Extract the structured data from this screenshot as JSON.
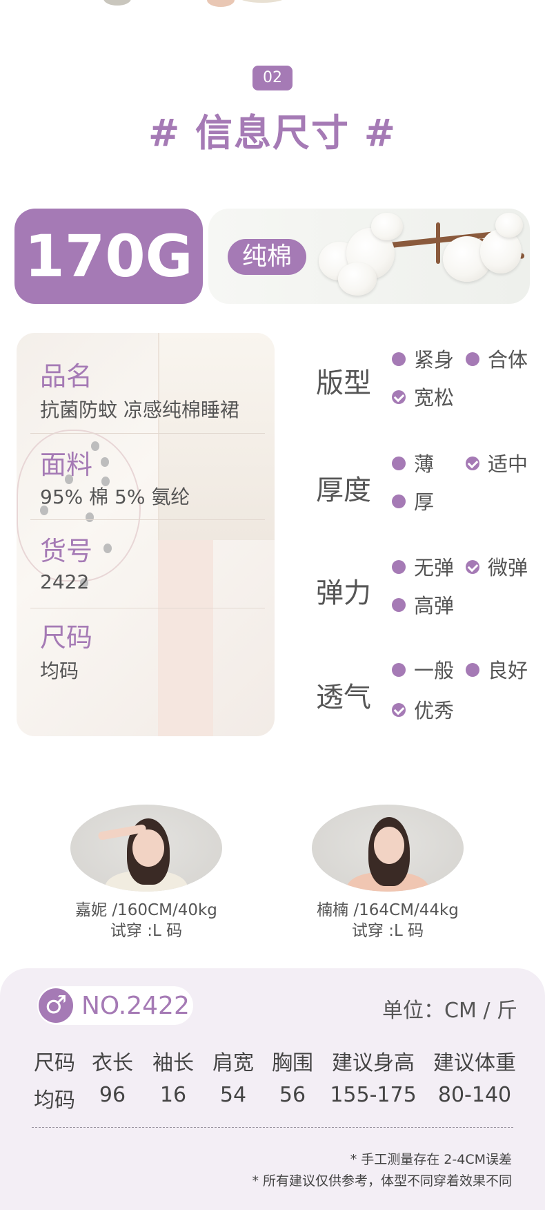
{
  "section": {
    "badge": "02",
    "title": "# 信息尺寸 #"
  },
  "weight": {
    "value": "170G",
    "material": "纯棉"
  },
  "info": {
    "name_label": "品名",
    "name_value": "抗菌防蚊 凉感纯棉睡裙",
    "fabric_label": "面料",
    "fabric_value": "95% 棉   5% 氨纶",
    "sku_label": "货号",
    "sku_value": "2422",
    "size_label": "尺码",
    "size_value": "均码"
  },
  "attributes": [
    {
      "name": "版型",
      "options": [
        {
          "label": "紧身",
          "checked": false
        },
        {
          "label": "合体",
          "checked": false
        },
        {
          "label": "宽松",
          "checked": true
        }
      ]
    },
    {
      "name": "厚度",
      "options": [
        {
          "label": "薄",
          "checked": false
        },
        {
          "label": "适中",
          "checked": true
        },
        {
          "label": "厚",
          "checked": false
        }
      ]
    },
    {
      "name": "弹力",
      "options": [
        {
          "label": "无弹",
          "checked": false
        },
        {
          "label": "微弹",
          "checked": true
        },
        {
          "label": "高弹",
          "checked": false
        }
      ]
    },
    {
      "name": "透气",
      "options": [
        {
          "label": "一般",
          "checked": false
        },
        {
          "label": "良好",
          "checked": false
        },
        {
          "label": "优秀",
          "checked": true
        }
      ]
    }
  ],
  "models": [
    {
      "info": "嘉妮 /160CM/40kg",
      "tryon": "试穿 :L 码"
    },
    {
      "info": "楠楠 /164CM/44kg",
      "tryon": "试穿 :L 码"
    }
  ],
  "size_table": {
    "gender_icon": "male-symbol-icon",
    "gender_symbol": "♂",
    "number": "NO.2422",
    "unit": "单位：CM / 斤",
    "headers": [
      "尺码",
      "衣长",
      "袖长",
      "肩宽",
      "胸围",
      "建议身高",
      "建议体重"
    ],
    "row": [
      "均码",
      "96",
      "16",
      "54",
      "56",
      "155-175",
      "80-140"
    ],
    "notes": [
      "* 手工测量存在 2-4CM误差",
      "* 所有建议仅供参考，体型不同穿着效果不同"
    ]
  },
  "colors": {
    "accent": "#a57ab5",
    "text": "#555555",
    "table_bg": "#f3eef5"
  }
}
